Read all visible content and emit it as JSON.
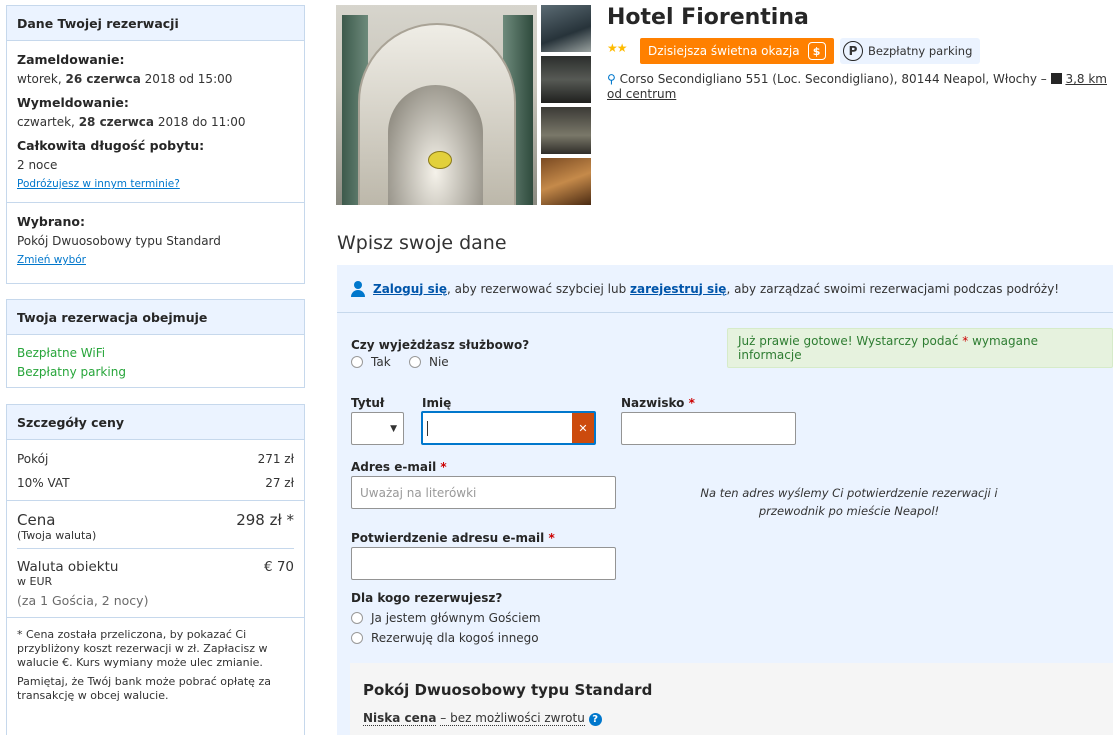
{
  "booking": {
    "title": "Dane Twojej rezerwacji",
    "checkin_label": "Zameldowanie:",
    "checkin_day": "wtorek,",
    "checkin_date": "26 czerwca",
    "checkin_rest": "2018 od 15:00",
    "checkout_label": "Wymeldowanie:",
    "checkout_day": "czwartek,",
    "checkout_date": "28 czerwca",
    "checkout_rest": "2018 do 11:00",
    "length_label": "Całkowita długość pobytu:",
    "length_value": "2 noce",
    "other_dates_link": "Podróżujesz w innym terminie?",
    "selected_label": "Wybrano:",
    "selected_value": "Pokój Dwuosobowy typu Standard",
    "change_link": "Zmień wybór"
  },
  "includes": {
    "title": "Twoja rezerwacja obejmuje",
    "items": [
      "Bezpłatne WiFi",
      "Bezpłatny parking"
    ]
  },
  "price": {
    "title": "Szczegóły ceny",
    "room_label": "Pokój",
    "room_value": "271 zł",
    "vat_label": "10% VAT",
    "vat_value": "27 zł",
    "total_label": "Cena",
    "total_sub": "(Twoja waluta)",
    "total_value": "298 zł *",
    "property_label": "Waluta obiektu",
    "property_sub": "w EUR",
    "property_value": "€ 70",
    "guests_note": "(za 1 Gościa, 2 nocy)",
    "footnote_1": "* Cena została przeliczona, by pokazać Ci przybliżony koszt rezerwacji w zł. Zapłacisz w walucie €. Kurs wymiany może ulec zmianie.",
    "footnote_2": "Pamiętaj, że Twój bank może pobrać opłatę za transakcję w obcej walucie."
  },
  "hotel": {
    "name": "Hotel Fiorentina",
    "stars": "★★",
    "deal": "Dzisiejsza świetna okazja",
    "parking": "Bezpłatny parking",
    "address": "Corso Secondigliano 551 (Loc. Secondigliano), 80144 Neapol, Włochy –",
    "distance": "3,8 km od centrum"
  },
  "form": {
    "heading": "Wpisz swoje dane",
    "login_link": "Zaloguj się",
    "login_text": ", aby rezerwować szybciej lub",
    "register_link": "zarejestruj się",
    "register_text": ", aby zarządzać swoimi rezerwacjami podczas podróży!",
    "business_question": "Czy wyjeżdżasz służbowo?",
    "yes": "Tak",
    "no": "Nie",
    "ready_notice_a": "Już prawie gotowe! Wystarczy podać",
    "ready_notice_b": "wymagane informacje",
    "title_label": "Tytuł",
    "firstname_label": "Imię",
    "lastname_label": "Nazwisko",
    "email_label": "Adres e-mail",
    "email_placeholder": "Uważaj na literówki",
    "email_note": "Na ten adres wyślemy Ci potwierdzenie rezerwacji i przewodnik po mieście Neapol!",
    "confirm_email_label": "Potwierdzenie adresu e-mail",
    "for_whom_label": "Dla kogo rezerwujesz?",
    "option_main_guest": "Ja jestem głównym Gościem",
    "option_other": "Rezerwuję dla kogoś innego",
    "room_title": "Pokój Dwuosobowy typu Standard",
    "rate_name": "Niska cena",
    "rate_desc": "– bez możliwości zwrotu"
  },
  "colors": {
    "accent_blue": "#0077cc",
    "panel_bg": "#ebf3ff",
    "deal_orange": "#ff8000",
    "success_green": "#27a53a",
    "focus_blue": "#0077cc",
    "clear_button": "#cc4b0d"
  }
}
